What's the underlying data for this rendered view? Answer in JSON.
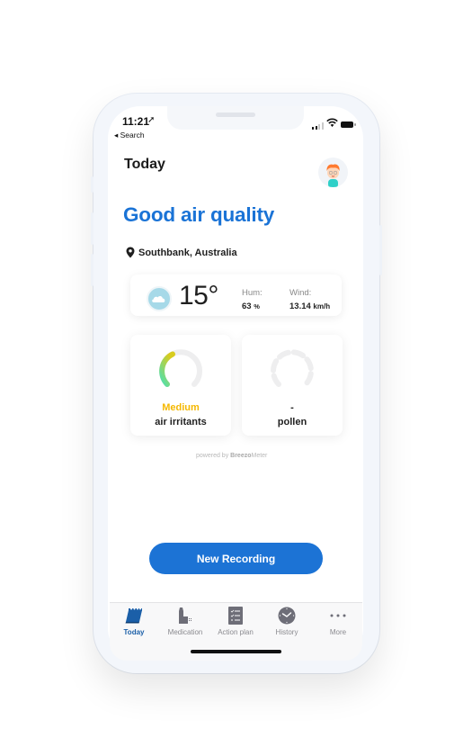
{
  "status_bar": {
    "time": "11:21",
    "location_arrow": "➚",
    "back_label": "◂ Search"
  },
  "header": {
    "title": "Today",
    "avatar": "child-avatar"
  },
  "air_quality": {
    "headline": "Good air quality",
    "location": "Southbank, Australia"
  },
  "weather": {
    "icon": "cloud-icon",
    "temperature": "15°",
    "humidity_label": "Hum:",
    "humidity_value": "63",
    "humidity_unit": "%",
    "wind_label": "Wind:",
    "wind_value": "13.14",
    "wind_unit": "km/h"
  },
  "cards": [
    {
      "level": "Medium",
      "label": "air irritants",
      "level_color": "#f5b800",
      "gauge_fraction": 0.35
    },
    {
      "level": "-",
      "label": "pollen",
      "level_color": "#222222",
      "gauge_fraction": 0
    }
  ],
  "attribution": {
    "prefix": "powered by ",
    "brand_bold": "Breezo",
    "brand_rest": "Meter"
  },
  "actions": {
    "new_recording": "New Recording"
  },
  "tabbar": {
    "items": [
      {
        "label": "Today",
        "icon": "calendar-icon",
        "active": true
      },
      {
        "label": "Medication",
        "icon": "inhaler-icon",
        "active": false
      },
      {
        "label": "Action plan",
        "icon": "checklist-icon",
        "active": false
      },
      {
        "label": "History",
        "icon": "clock-icon",
        "active": false
      },
      {
        "label": "More",
        "icon": "more-dots-icon",
        "active": false
      }
    ]
  },
  "colors": {
    "accent": "#1a73d6",
    "button": "#1c73d5",
    "medium": "#f5b800",
    "tab_active": "#1b5fa8",
    "tab_inactive": "#8a8a8f"
  }
}
